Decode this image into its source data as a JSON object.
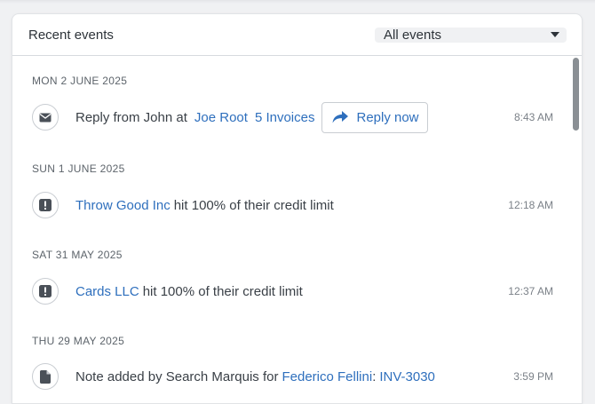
{
  "header": {
    "title": "Recent events",
    "filter_value": "All events"
  },
  "groups": [
    {
      "date": "MON 2 JUNE 2025",
      "event": {
        "icon": "envelope-icon",
        "prefix": "Reply from John at",
        "link1": "Joe Root",
        "link2": "5 Invoices",
        "button_label": "Reply now",
        "time": "8:43 AM"
      }
    },
    {
      "date": "SUN 1 JUNE 2025",
      "event": {
        "icon": "exclamation-icon",
        "link": "Throw Good Inc",
        "suffix": "hit 100% of their credit limit",
        "time": "12:18 AM"
      }
    },
    {
      "date": "SAT 31 MAY 2025",
      "event": {
        "icon": "exclamation-icon",
        "link": "Cards LLC",
        "suffix": "hit 100% of their credit limit",
        "time": "12:37 AM"
      }
    },
    {
      "date": "THU 29 MAY 2025",
      "event": {
        "icon": "document-icon",
        "prefix": "Note added by Search Marquis for",
        "link1": "Federico Fellini",
        "separator": ":",
        "link2": "INV-3030",
        "time": "3:59 PM"
      }
    }
  ]
}
